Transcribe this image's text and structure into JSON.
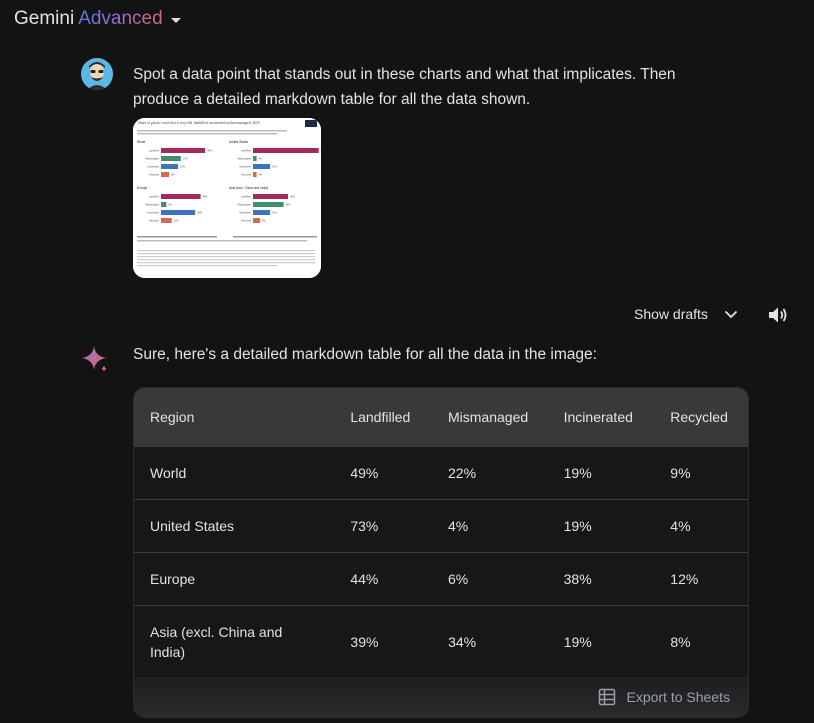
{
  "header": {
    "brand": "Gemini",
    "tier": "Advanced"
  },
  "user_message": {
    "text": "Spot a data point that stands out in these charts and what that implicates. Then produce a detailed markdown table for all the data shown.",
    "attachment": {
      "title": "Share of plastic waste that is recycled, landfilled, incinerated and mismanaged, 2019",
      "panels": [
        {
          "name": "World",
          "values": [
            49,
            22,
            19,
            9
          ]
        },
        {
          "name": "United States",
          "values": [
            73,
            4,
            19,
            4
          ]
        },
        {
          "name": "Europe",
          "values": [
            44,
            6,
            38,
            12
          ]
        },
        {
          "name": "Asia (excl. China and India)",
          "values": [
            39,
            34,
            19,
            8
          ]
        }
      ],
      "categories": [
        "Landfilled",
        "Mismanaged",
        "Incinerated",
        "Recycled"
      ]
    }
  },
  "drafts": {
    "label": "Show drafts"
  },
  "response": {
    "intro": "Sure, here's a detailed markdown table for all the data in the image:",
    "table": {
      "headers": [
        "Region",
        "Landfilled",
        "Mismanaged",
        "Incinerated",
        "Recycled"
      ],
      "rows": [
        [
          "World",
          "49%",
          "22%",
          "19%",
          "9%"
        ],
        [
          "United States",
          "73%",
          "4%",
          "19%",
          "4%"
        ],
        [
          "Europe",
          "44%",
          "6%",
          "38%",
          "12%"
        ],
        [
          "Asia (excl. China and India)",
          "39%",
          "34%",
          "19%",
          "8%"
        ]
      ]
    },
    "export_label": "Export to Sheets"
  },
  "colors": {
    "background": "#131314",
    "landfilled": "#a3285c",
    "mismanaged": "#3f8f6f",
    "incinerated": "#3b74bd",
    "recycled": "#d76a52"
  },
  "icons": [
    "chevron-down-icon",
    "speaker-icon",
    "sparkle-icon",
    "sheets-icon",
    "avatar-icon"
  ]
}
